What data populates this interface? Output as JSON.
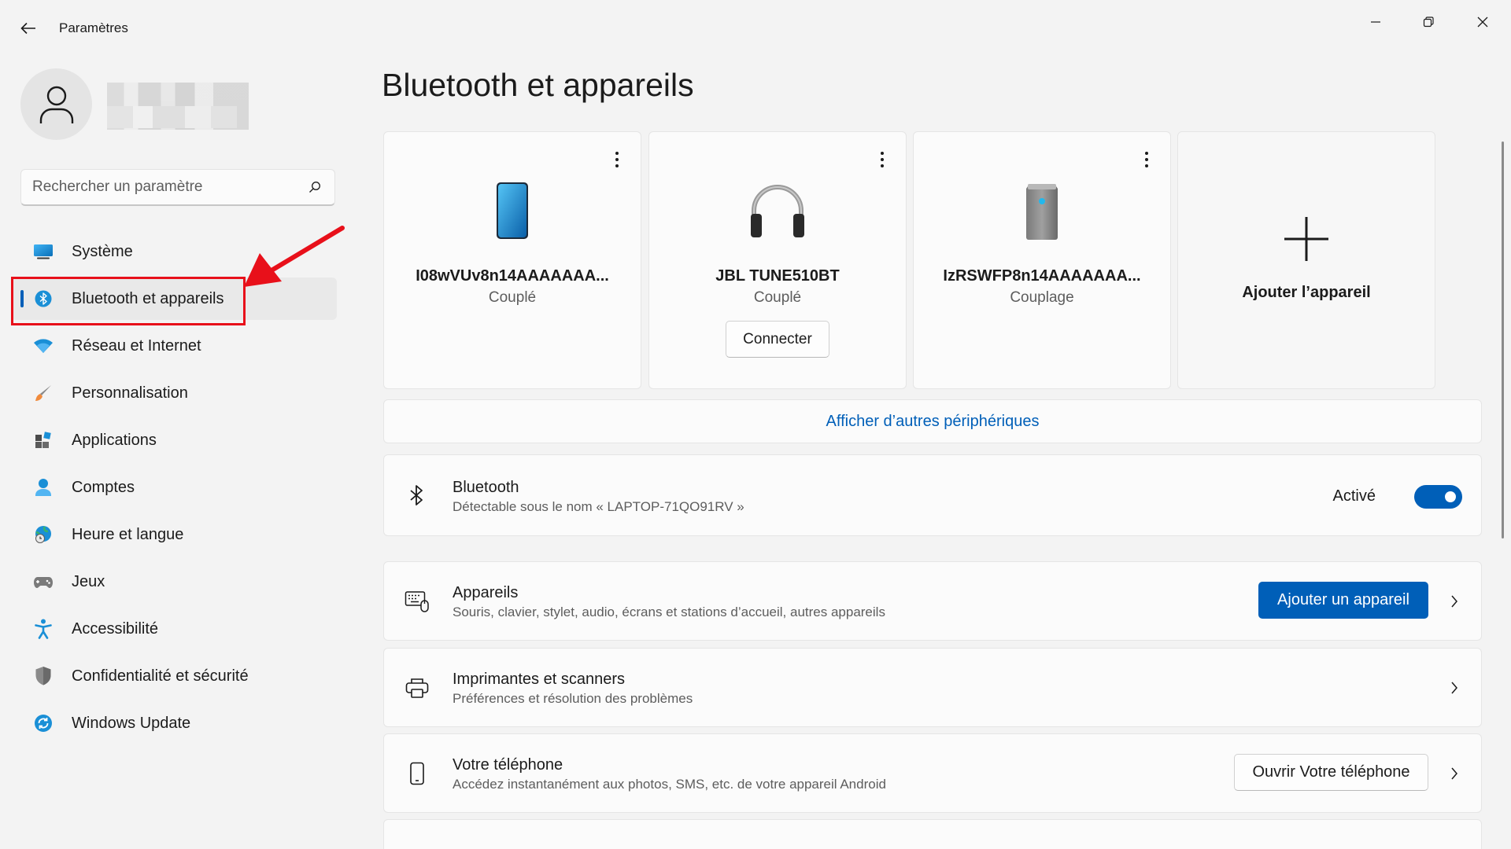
{
  "titlebar": {
    "title": "Paramètres"
  },
  "sidebar": {
    "search_placeholder": "Rechercher un paramètre",
    "items": [
      {
        "label": "Système",
        "icon": "system-icon"
      },
      {
        "label": "Bluetooth et appareils",
        "icon": "bluetooth-icon",
        "selected": true
      },
      {
        "label": "Réseau et Internet",
        "icon": "wifi-icon"
      },
      {
        "label": "Personnalisation",
        "icon": "brush-icon"
      },
      {
        "label": "Applications",
        "icon": "apps-icon"
      },
      {
        "label": "Comptes",
        "icon": "account-icon"
      },
      {
        "label": "Heure et langue",
        "icon": "globe-clock-icon"
      },
      {
        "label": "Jeux",
        "icon": "gamepad-icon"
      },
      {
        "label": "Accessibilité",
        "icon": "accessibility-icon"
      },
      {
        "label": "Confidentialité et sécurité",
        "icon": "shield-icon"
      },
      {
        "label": "Windows Update",
        "icon": "update-icon"
      }
    ]
  },
  "main": {
    "title": "Bluetooth et appareils",
    "devices": [
      {
        "name": "I08wVUv8n14AAAAAAA...",
        "status": "Couplé",
        "icon": "phone-icon"
      },
      {
        "name": "JBL TUNE510BT",
        "status": "Couplé",
        "icon": "headphones-icon",
        "button": "Connecter"
      },
      {
        "name": "IzRSWFP8n14AAAAAAA...",
        "status": "Couplage",
        "icon": "speaker-icon"
      }
    ],
    "add_device_card": "Ajouter l’appareil",
    "more_devices_link": "Afficher d’autres périphériques",
    "bluetooth": {
      "title": "Bluetooth",
      "subtitle": "Détectable sous le nom « LAPTOP-71QO91RV »",
      "state_label": "Activé",
      "on": true
    },
    "appareils": {
      "title": "Appareils",
      "subtitle": "Souris, clavier, stylet, audio, écrans et stations d’accueil, autres appareils",
      "button": "Ajouter un appareil"
    },
    "printers": {
      "title": "Imprimantes et scanners",
      "subtitle": "Préférences et résolution des problèmes"
    },
    "phone": {
      "title": "Votre téléphone",
      "subtitle": "Accédez instantanément aux photos, SMS, etc. de votre appareil Android",
      "button": "Ouvrir Votre téléphone"
    }
  },
  "colors": {
    "accent": "#005fb8",
    "annotation": "#e8101a"
  }
}
